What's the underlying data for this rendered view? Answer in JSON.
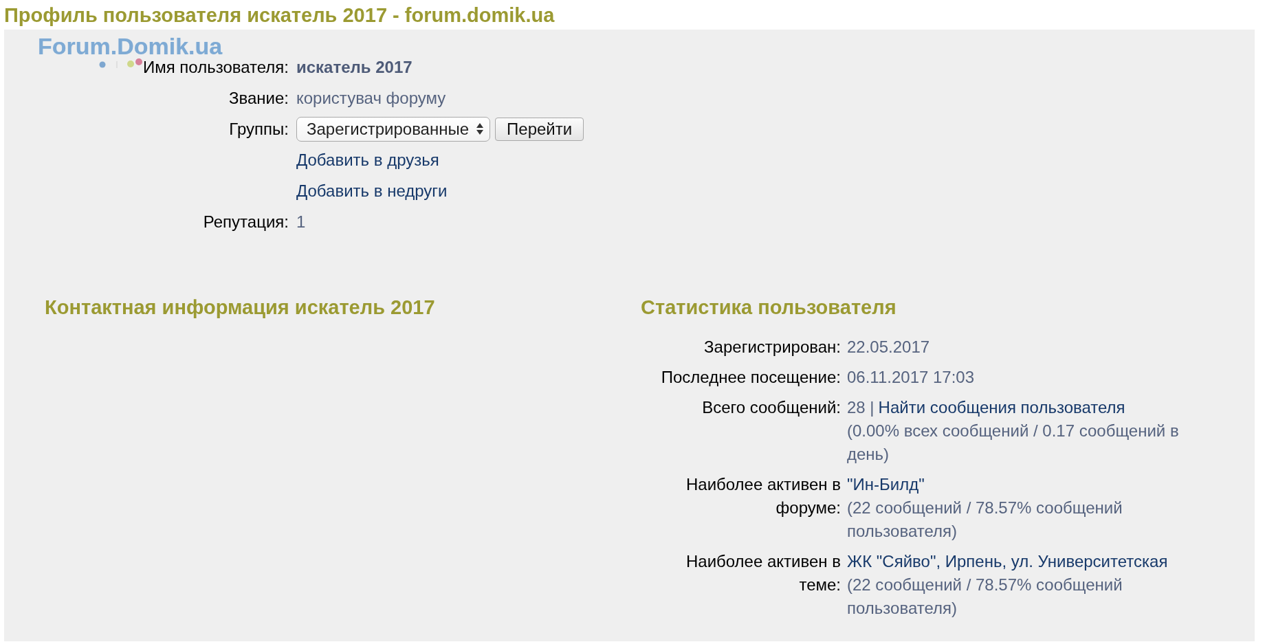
{
  "page_title": "Профиль пользователя искатель 2017 - forum.domik.ua",
  "logo": {
    "text": "Forum.Domik.ua"
  },
  "profile": [
    {
      "kind": "text",
      "label": "Имя пользователя:",
      "value": "искатель 2017",
      "bold": true
    },
    {
      "kind": "text",
      "label": "Звание:",
      "value": "користувач форуму",
      "bold": false
    },
    {
      "kind": "select",
      "label": "Группы:",
      "value": "Зарегистрированные",
      "button": "Перейти"
    },
    {
      "kind": "link",
      "value": "Добавить в друзья"
    },
    {
      "kind": "link",
      "value": "Добавить в недруги"
    },
    {
      "kind": "text",
      "label": "Репутация:",
      "value": "1",
      "bold": false
    }
  ],
  "contact": {
    "heading": "Контактная информация искатель 2017"
  },
  "stats": {
    "heading": "Статистика пользователя",
    "rows": [
      {
        "label": "Зарегистрирован:",
        "value": "22.05.2017"
      },
      {
        "label": "Последнее посещение:",
        "value": "06.11.2017 17:03"
      },
      {
        "label": "Всего сообщений:",
        "value": "28 |",
        "link": "Найти сообщения пользователя",
        "note": "(0.00% всех сообщений / 0.17 сообщений в день)"
      },
      {
        "label": "Наиболее активен в форуме:",
        "link": "\"Ин-Билд\"",
        "note": "(22 сообщений / 78.57% сообщений пользователя)"
      },
      {
        "label": "Наиболее активен в теме:",
        "link": "ЖК \"Сяйво\", Ирпень, ул. Университетская",
        "note": "(22 сообщений / 78.57% сообщений пользователя)"
      }
    ]
  }
}
